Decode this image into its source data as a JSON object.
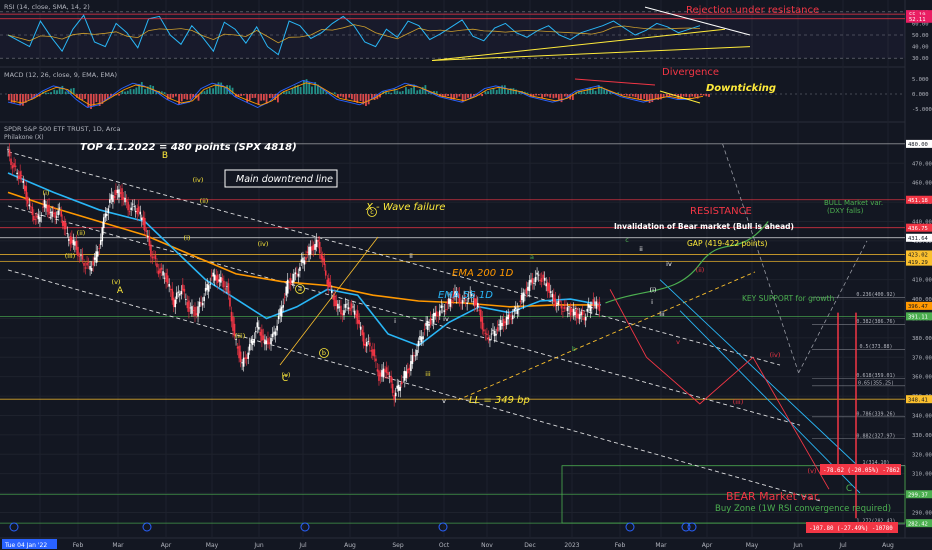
{
  "chart_data": {
    "type": "line",
    "panes": {
      "rsi": {
        "label": "RSI (14, close, SMA, 14, 2)",
        "ticks": [
          "70.00",
          "60.00",
          "50.00",
          "40.00",
          "30.00"
        ],
        "ylim": [
          25,
          75
        ],
        "badges": [
          {
            "text": "55.19",
            "value": 68,
            "color": "#e91e63"
          },
          {
            "text": "52.11",
            "value": 64,
            "color": "#e91e63"
          }
        ],
        "annotation": "Rejection under resistance"
      },
      "macd": {
        "label": "MACD (12, 26, close, 9, EMA, EMA)",
        "ticks": [
          "5.000",
          "0.000",
          "-5.000"
        ],
        "ylim": [
          -8,
          8
        ],
        "annotations": [
          "Divergence",
          "Downticking"
        ]
      },
      "price": {
        "label": "SPDR S&P 500 ETF TRUST, 1D, Arca",
        "sublabel": "Philakone (X)",
        "ylim": [
          282,
          482
        ],
        "ticks": [
          "480.00",
          "470.00",
          "460.00",
          "450.00",
          "440.00",
          "430.00",
          "420.00",
          "410.00",
          "400.00",
          "390.00",
          "380.00",
          "370.00",
          "360.00",
          "350.00",
          "340.00",
          "330.00",
          "320.00",
          "310.00",
          "300.00",
          "290.00"
        ],
        "price_badges": [
          {
            "text": "480.00",
            "value": 480,
            "color": "#ffffff",
            "fg": "#131722"
          },
          {
            "text": "451.18",
            "value": 451.2,
            "color": "#f23645",
            "fg": "#ffffff"
          },
          {
            "text": "436.75",
            "value": 436.8,
            "color": "#f23645",
            "fg": "#ffffff"
          },
          {
            "text": "431.64",
            "value": 431.6,
            "color": "#ffffff",
            "fg": "#131722"
          },
          {
            "text": "423.02",
            "value": 423.0,
            "color": "#fbc02d",
            "fg": "#131722"
          },
          {
            "text": "419.29",
            "value": 419.3,
            "color": "#fbc02d",
            "fg": "#131722"
          },
          {
            "text": "396.47",
            "value": 396.5,
            "color": "#ff9800",
            "fg": "#131722"
          },
          {
            "text": "391.11",
            "value": 391.1,
            "color": "#4caf50",
            "fg": "#ffffff"
          },
          {
            "text": "348.41",
            "value": 348.4,
            "color": "#fbc02d",
            "fg": "#131722"
          },
          {
            "text": "299.37",
            "value": 299.4,
            "color": "#4caf50",
            "fg": "#ffffff"
          },
          {
            "text": "282.42",
            "value": 284.5,
            "color": "#4caf50",
            "fg": "#ffffff"
          }
        ],
        "fib_levels": [
          {
            "label": "0.236(400.92)",
            "value": 400.9
          },
          {
            "label": "0.382(386.76)",
            "value": 386.8
          },
          {
            "label": "0.5(373.88)",
            "value": 373.9
          },
          {
            "label": "0.618(359.01)",
            "value": 359.0
          },
          {
            "label": "0.65(355.25)",
            "value": 355.3
          },
          {
            "label": "0.786(339.26)",
            "value": 339.3
          },
          {
            "label": "0.882(327.97)",
            "value": 328.0
          },
          {
            "label": "1(314.10)",
            "value": 314.1
          },
          {
            "label": "1.272(282.43)",
            "value": 284.0
          }
        ],
        "annotations": {
          "top": "TOP 4.1.2022 = 480 points (SPX 4818)",
          "downtrend": "Main downtrend line",
          "wave_failure": "X - Wave failure",
          "resistance": "RESISTANCE",
          "invalidation": "Invalidation of Bear market (Bull is ahead)",
          "gap": "GAP (419-422 points)",
          "ema200": "EMA 200 1D",
          "ema55": "EMA 55 1D",
          "key_support": "KEY SUPPORT for growth",
          "ll": "LL = 349 bp",
          "bull_line1": "BULL Market var.",
          "bull_line2": "(DXY falls)",
          "bear": "BEAR Market var.",
          "buy_zone": "Buy Zone (1W RSI convergence required)",
          "box1": "-78.62 (-20.05%) -7862",
          "box2": "-107.80 (-27.49%) -10780"
        },
        "wave_labels": [
          "(i)",
          "(ii)",
          "(iii)",
          "(iv)",
          "(v)",
          "(i)",
          "(ii)",
          "(iii)",
          "(iv)",
          "(v)",
          "A",
          "B",
          "C",
          "a",
          "b",
          "c",
          "i",
          "ii",
          "iii",
          "iv",
          "v",
          "a",
          "b",
          "c",
          "i",
          "ii",
          "iii",
          "iv",
          "v",
          "(i)",
          "(ii)",
          "(iii)",
          "(iv)",
          "(v)",
          "C"
        ]
      }
    },
    "x_axis": {
      "ticks": [
        "Tue 04 Jan '22",
        "Feb",
        "Mar",
        "Apr",
        "May",
        "Jun",
        "Jul",
        "Aug",
        "Sep",
        "Oct",
        "Nov",
        "Dec",
        "2023",
        "Feb",
        "Mar",
        "Apr",
        "May",
        "Jun",
        "Jul",
        "Aug"
      ],
      "unit": "days since 2022-01-04"
    },
    "series": [
      {
        "name": "SPY close",
        "color": "#26a69a",
        "points": [
          [
            0,
            477
          ],
          [
            5,
            467
          ],
          [
            10,
            462
          ],
          [
            15,
            447
          ],
          [
            20,
            440
          ],
          [
            25,
            449
          ],
          [
            30,
            443
          ],
          [
            35,
            445
          ],
          [
            40,
            432
          ],
          [
            45,
            428
          ],
          [
            50,
            419
          ],
          [
            55,
            416
          ],
          [
            60,
            424
          ],
          [
            65,
            444
          ],
          [
            70,
            454
          ],
          [
            75,
            455
          ],
          [
            80,
            447
          ],
          [
            85,
            447
          ],
          [
            90,
            440
          ],
          [
            95,
            424
          ],
          [
            100,
            415
          ],
          [
            105,
            411
          ],
          [
            110,
            398
          ],
          [
            115,
            406
          ],
          [
            120,
            395
          ],
          [
            125,
            393
          ],
          [
            130,
            402
          ],
          [
            135,
            412
          ],
          [
            140,
            410
          ],
          [
            145,
            406
          ],
          [
            150,
            380
          ],
          [
            155,
            366
          ],
          [
            160,
            375
          ],
          [
            165,
            386
          ],
          [
            170,
            377
          ],
          [
            175,
            380
          ],
          [
            180,
            393
          ],
          [
            185,
            408
          ],
          [
            190,
            412
          ],
          [
            195,
            420
          ],
          [
            200,
            426
          ],
          [
            205,
            429
          ],
          [
            210,
            412
          ],
          [
            215,
            400
          ],
          [
            220,
            393
          ],
          [
            225,
            397
          ],
          [
            230,
            392
          ],
          [
            235,
            378
          ],
          [
            240,
            375
          ],
          [
            245,
            360
          ],
          [
            250,
            364
          ],
          [
            255,
            350
          ],
          [
            260,
            358
          ],
          [
            265,
            365
          ],
          [
            270,
            375
          ],
          [
            275,
            385
          ],
          [
            280,
            390
          ],
          [
            285,
            394
          ],
          [
            290,
            397
          ],
          [
            295,
            403
          ],
          [
            300,
            398
          ],
          [
            305,
            402
          ],
          [
            310,
            396
          ],
          [
            315,
            380
          ],
          [
            320,
            382
          ],
          [
            325,
            387
          ],
          [
            330,
            390
          ],
          [
            335,
            394
          ],
          [
            340,
            402
          ],
          [
            345,
            409
          ],
          [
            350,
            412
          ],
          [
            355,
            408
          ],
          [
            360,
            399
          ],
          [
            365,
            396
          ],
          [
            370,
            394
          ],
          [
            375,
            392
          ],
          [
            380,
            391
          ],
          [
            385,
            398
          ],
          [
            390,
            396
          ]
        ]
      },
      {
        "name": "EMA 200 1D",
        "color": "#ff9800",
        "points": [
          [
            0,
            455
          ],
          [
            30,
            447
          ],
          [
            60,
            440
          ],
          [
            90,
            433
          ],
          [
            120,
            423
          ],
          [
            150,
            413
          ],
          [
            180,
            409
          ],
          [
            210,
            407
          ],
          [
            240,
            402
          ],
          [
            270,
            399
          ],
          [
            300,
            398
          ],
          [
            330,
            396
          ],
          [
            360,
            397
          ],
          [
            390,
            397
          ]
        ]
      },
      {
        "name": "EMA 55 1D",
        "color": "#29b6f6",
        "points": [
          [
            0,
            465
          ],
          [
            30,
            455
          ],
          [
            60,
            446
          ],
          [
            90,
            440
          ],
          [
            110,
            425
          ],
          [
            130,
            410
          ],
          [
            150,
            400
          ],
          [
            170,
            390
          ],
          [
            190,
            396
          ],
          [
            210,
            405
          ],
          [
            230,
            402
          ],
          [
            250,
            382
          ],
          [
            270,
            376
          ],
          [
            290,
            388
          ],
          [
            310,
            396
          ],
          [
            330,
            393
          ],
          [
            350,
            399
          ],
          [
            370,
            400
          ],
          [
            390,
            397
          ]
        ]
      }
    ],
    "rsi_series": [
      50,
      45,
      40,
      62,
      48,
      36,
      55,
      67,
      44,
      40,
      60,
      52,
      39,
      64,
      66,
      50,
      42,
      58,
      48,
      36,
      61,
      55,
      43,
      57,
      40,
      33,
      62,
      58,
      47,
      52,
      60,
      66,
      58,
      44,
      40,
      55,
      48,
      62,
      58,
      46,
      51,
      57,
      63,
      49,
      45,
      56,
      60,
      52,
      48,
      54,
      58,
      50,
      46,
      52,
      55,
      58,
      62,
      56,
      50,
      54,
      60,
      57,
      52,
      55,
      58
    ],
    "macd_hist": [
      -3,
      -4,
      -2,
      1,
      3,
      2,
      -2,
      -5,
      -4,
      -1,
      2,
      4,
      3,
      1,
      -2,
      -4,
      -3,
      2,
      4,
      3,
      -1,
      -3,
      -5,
      -3,
      1,
      3,
      5,
      4,
      1,
      -2,
      -3,
      -4,
      -2,
      1,
      2,
      4,
      3,
      1,
      -1,
      -2,
      -3,
      -1,
      2,
      3,
      2,
      1,
      -1,
      -2,
      -3,
      -2,
      1,
      2,
      3,
      1,
      -1,
      -2,
      -3,
      -2,
      -1,
      -2,
      -2,
      -1
    ]
  }
}
